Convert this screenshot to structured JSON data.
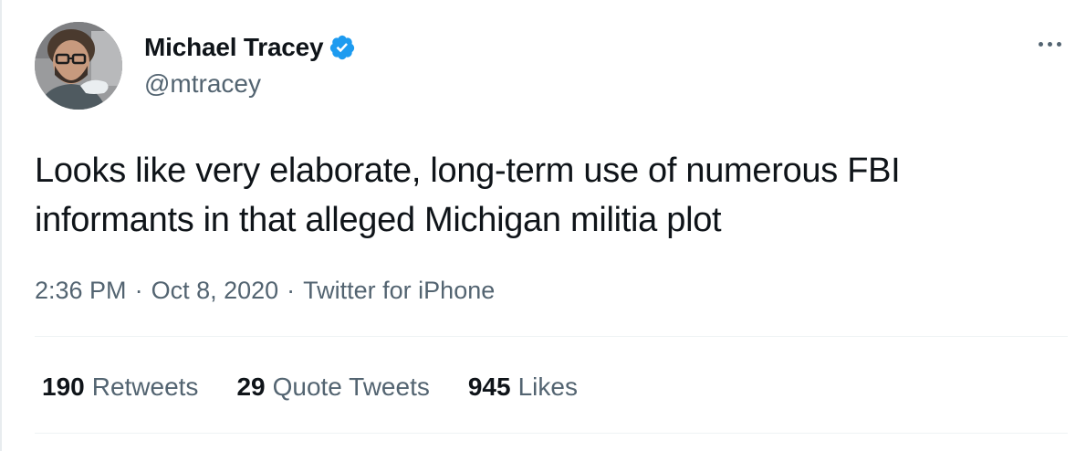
{
  "author": {
    "display_name": "Michael Tracey",
    "handle": "@mtracey",
    "verified_icon": "verified-badge-icon"
  },
  "tweet": {
    "text": "Looks like very elaborate, long-term use of numerous FBI\ninformants in that alleged Michigan militia plot",
    "time": "2:36 PM",
    "separator": "·",
    "date": "Oct 8, 2020",
    "source": "Twitter for iPhone"
  },
  "stats": {
    "retweets_count": "190",
    "retweets_label": "Retweets",
    "quotes_count": "29",
    "quotes_label": "Quote Tweets",
    "likes_count": "945",
    "likes_label": "Likes"
  },
  "colors": {
    "text_primary": "#0f1419",
    "text_secondary": "#536471",
    "verified_blue": "#1d9bf0",
    "divider": "#eff3f4"
  },
  "icons": {
    "more": "more-options-icon"
  }
}
